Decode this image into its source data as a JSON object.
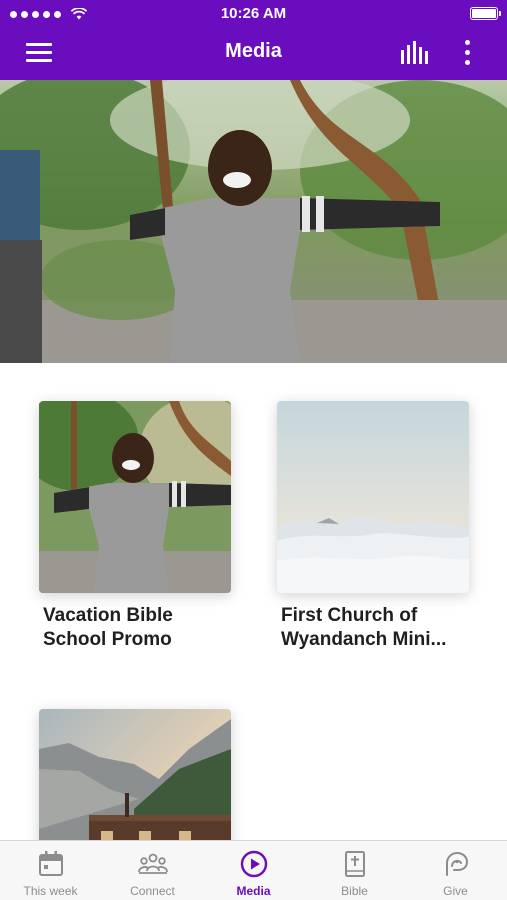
{
  "status_bar": {
    "time": "10:26 AM"
  },
  "nav": {
    "title": "Media"
  },
  "cards": [
    {
      "title": "Vacation Bible School Promo"
    },
    {
      "title": "First Church of Wyandanch Mini..."
    },
    {
      "title": ""
    }
  ],
  "tabs": [
    {
      "label": "This week",
      "icon": "calendar-icon"
    },
    {
      "label": "Connect",
      "icon": "people-icon"
    },
    {
      "label": "Media",
      "icon": "play-circle-icon",
      "active": true
    },
    {
      "label": "Bible",
      "icon": "bible-icon"
    },
    {
      "label": "Give",
      "icon": "give-icon"
    }
  ],
  "colors": {
    "brand": "#6a0dbf",
    "tab_inactive": "#8c8c8c"
  }
}
